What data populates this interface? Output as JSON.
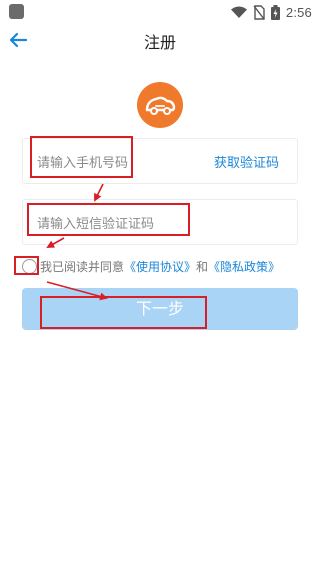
{
  "status_bar": {
    "time": "2:56",
    "icons": [
      "wifi-icon",
      "no-sim-icon",
      "battery-icon"
    ]
  },
  "header": {
    "title": "注册"
  },
  "form": {
    "phone_placeholder": "请输入手机号码",
    "get_code_label": "获取验证码",
    "sms_placeholder": "请输入短信验证证码"
  },
  "agreement": {
    "prefix": "我已阅读并同意",
    "terms_link": "《使用协议》",
    "and": "和",
    "privacy_link": "《隐私政策》"
  },
  "next_button": {
    "label": "下一步"
  },
  "colors": {
    "accent": "#1a87d8",
    "logo": "#f07a2c",
    "button_bg": "#a9d4f6",
    "annotation": "#d91f26"
  }
}
